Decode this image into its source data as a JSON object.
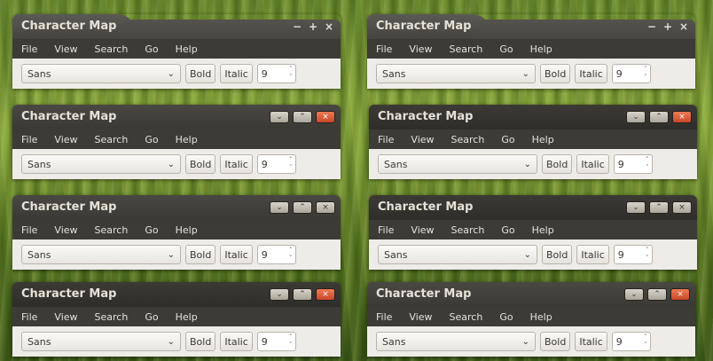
{
  "app_title": "Character Map",
  "menu": [
    "File",
    "View",
    "Search",
    "Go",
    "Help"
  ],
  "font_value": "Sans",
  "bold_label": "Bold",
  "italic_label": "Italic",
  "size_value": "9",
  "icons": {
    "minimize_plain": "−",
    "maximize_plain": "+",
    "close_plain": "×",
    "minimize": "⌄",
    "maximize": "⌃",
    "close": "×",
    "dropdown": "⌄",
    "spin_up": "˄",
    "spin_down": "˅"
  },
  "colors": {
    "titlebar": "#45433e",
    "close_accent": "#e0613a",
    "toolbar_bg": "#eeece8"
  }
}
